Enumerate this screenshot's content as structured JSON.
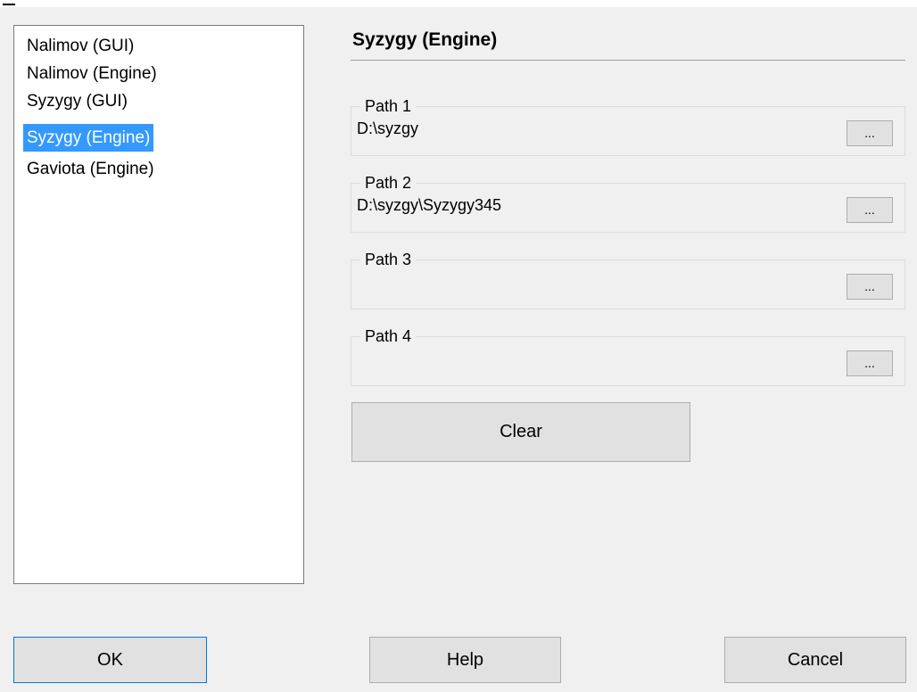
{
  "categories": {
    "items": [
      {
        "label": "Nalimov (GUI)"
      },
      {
        "label": "Nalimov (Engine)"
      },
      {
        "label": "Syzygy (GUI)"
      },
      {
        "label": "Syzygy (Engine)",
        "selected": true
      },
      {
        "label": "Gaviota (Engine)"
      }
    ]
  },
  "panel": {
    "title": "Syzygy (Engine)",
    "paths": [
      {
        "legend": "Path 1",
        "value": "D:\\syzgy",
        "browse_label": "..."
      },
      {
        "legend": "Path 2",
        "value": "D:\\syzgy\\Syzygy345",
        "browse_label": "..."
      },
      {
        "legend": "Path 3",
        "value": "",
        "browse_label": "..."
      },
      {
        "legend": "Path 4",
        "value": "",
        "browse_label": "..."
      }
    ],
    "clear_label": "Clear"
  },
  "footer": {
    "ok_label": "OK",
    "help_label": "Help",
    "cancel_label": "Cancel"
  },
  "colors": {
    "selection_background": "#3399ff",
    "dialog_background": "#f0f0f0",
    "default_button_border": "#0078d7"
  }
}
